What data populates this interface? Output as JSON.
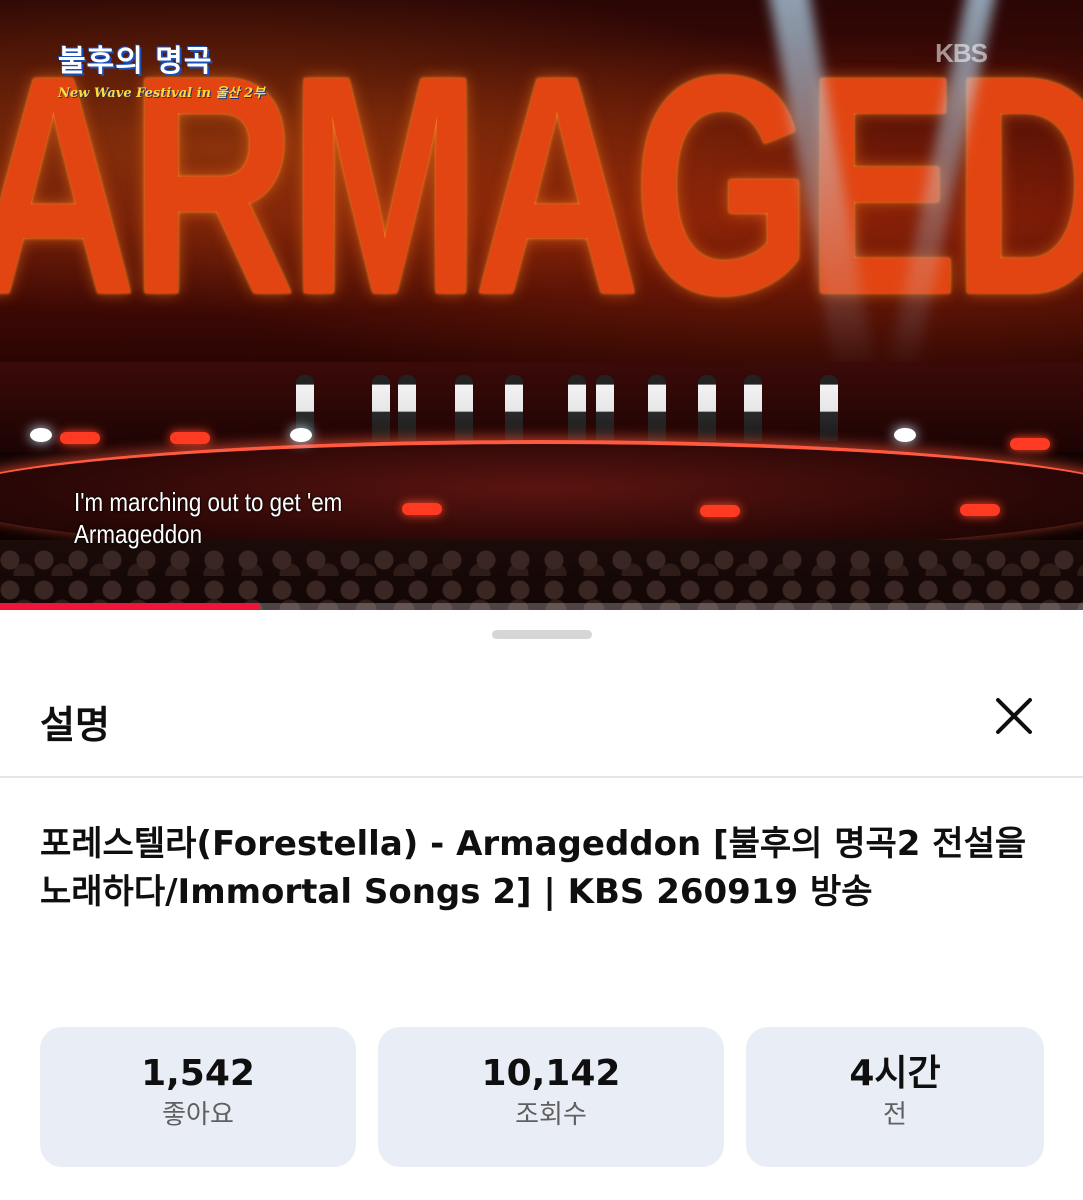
{
  "video": {
    "screen_text": "ARMAGEDDON",
    "logo_title": "불후의 명곡",
    "logo_subtitle": "New Wave Festival in 울산 2부",
    "broadcaster_mark": "KBS",
    "subtitle_line1": "I'm marching out to get 'em",
    "subtitle_line2": "Armageddon",
    "progress_fraction": 0.24
  },
  "sheet": {
    "title": "설명",
    "close_icon": "close-icon",
    "video_title": "포레스텔라(Forestella) - Armageddon [불후의 명곡2 전설을 노래하다/Immortal Songs 2] | KBS 260919 방송",
    "stats": [
      {
        "value": "1,542",
        "label": "좋아요"
      },
      {
        "value": "10,142",
        "label": "조회수"
      },
      {
        "value": "4시간",
        "label": "전"
      }
    ]
  },
  "colors": {
    "progress": "#f0133a",
    "stat_bg": "#e9eef6",
    "text_primary": "#0f0f0f",
    "text_secondary": "#606060"
  }
}
